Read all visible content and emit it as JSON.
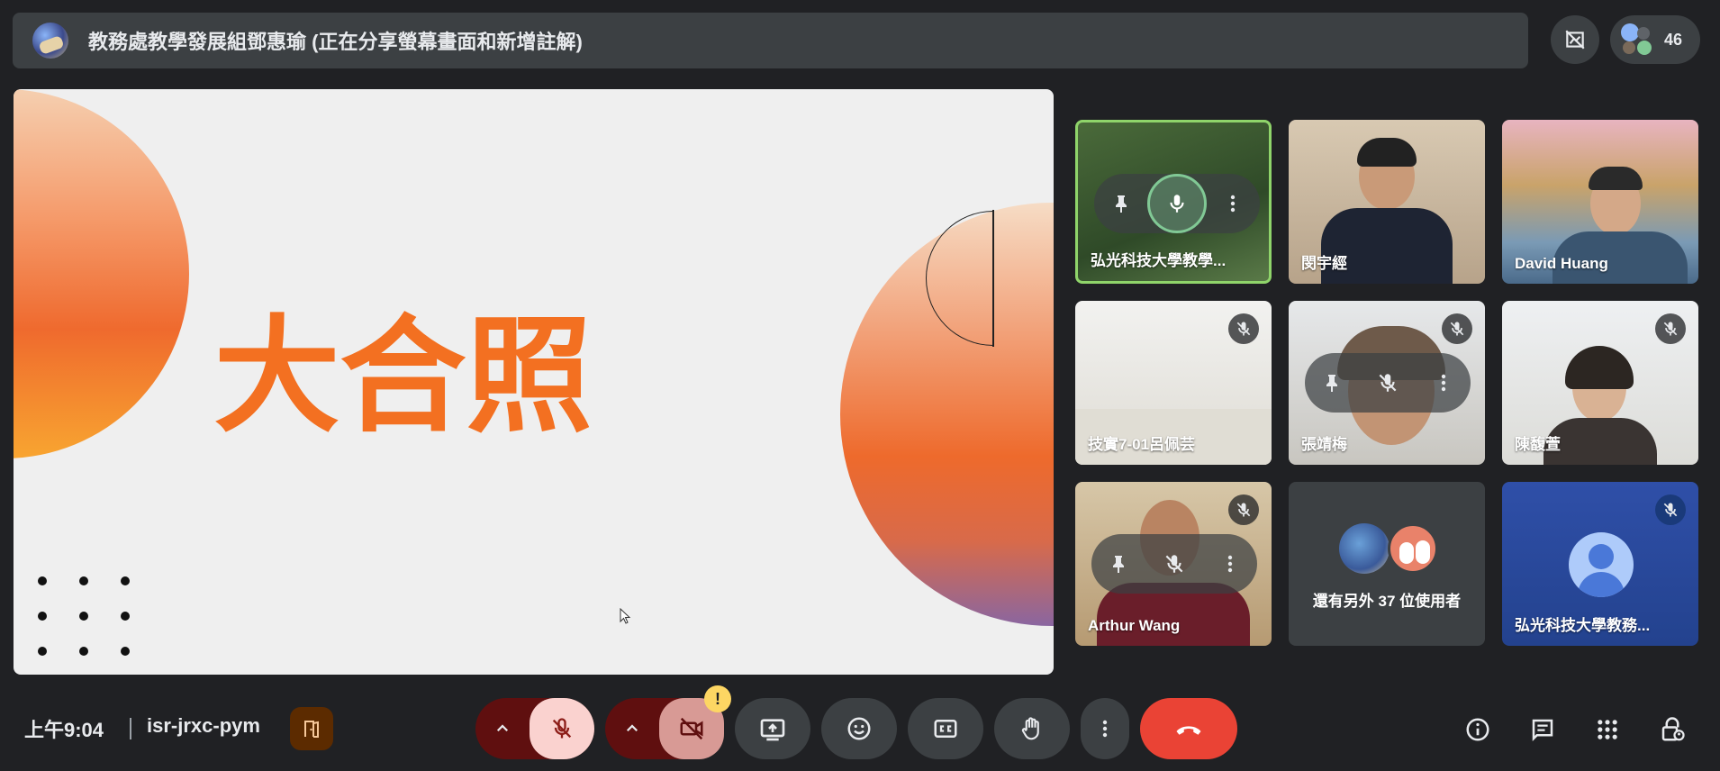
{
  "top_bar": {
    "presenter_text": "教務處教學發展組鄧惠瑜 (正在分享螢幕畫面和新增註解)",
    "participant_count": "46"
  },
  "slide": {
    "title": "大合照"
  },
  "tiles": [
    {
      "name": "弘光科技大學教學...",
      "speaking": true
    },
    {
      "name": "閔宇經"
    },
    {
      "name": "David Huang"
    },
    {
      "name": "技實7-01呂佩芸",
      "muted": true
    },
    {
      "name": "張靖梅",
      "muted": true
    },
    {
      "name": "陳馥萱",
      "muted": true
    },
    {
      "name": "Arthur Wang",
      "muted": true
    },
    {
      "name": "還有另外 37 位使用者"
    },
    {
      "name": "弘光科技大學教務...",
      "muted": true
    }
  ],
  "bottom_bar": {
    "time": "上午9:04",
    "meeting_code": "isr-jrxc-pym",
    "camera_warning": "!"
  },
  "colors": {
    "background": "#202124",
    "slide_title": "#f37021",
    "leave_button": "#ea4335",
    "speaking_border": "#8fd46a"
  }
}
